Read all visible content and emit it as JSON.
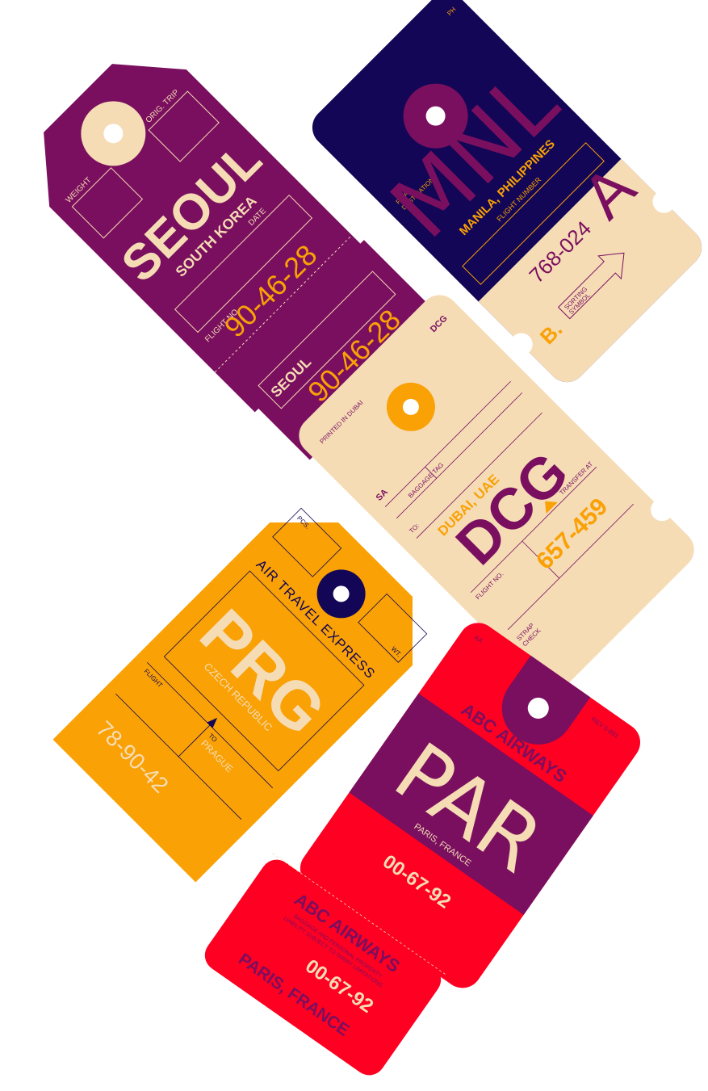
{
  "colors": {
    "plum": "#7a0f5f",
    "navy": "#130656",
    "cream": "#f5dcb5",
    "amber": "#f9a105",
    "red": "#fe0022"
  },
  "tags": {
    "seoul": {
      "orig_trip": "ORIG. TRIP",
      "weight": "WEIGHT",
      "city": "SEOUL",
      "country": "SOUTH KOREA",
      "date": "DATE",
      "flight_no": "FLIGHT NO.",
      "flight_number": "90-46-28",
      "stub_city": "SEOUL",
      "stub_number": "90-46-28"
    },
    "manila": {
      "corner_code": "PH",
      "final_destination_1": "FINAL",
      "final_destination_2": "DESTINATION",
      "code": "MNL",
      "city": "MANILA, PHILIPPINES",
      "flight_number_label": "FLIGHT NUMBER",
      "number": "768-024",
      "letter_a": "A",
      "letter_b": "B.",
      "sorting_1": "SORTING",
      "sorting_2": "SYMBOL"
    },
    "dubai": {
      "printed": "PRINTED IN DUBAI",
      "corner_code": "DCG",
      "sa": "SA",
      "baggage_tag": "BAGGAGE TAG",
      "to": "TO:",
      "city": "DUBAI, UAE",
      "code": "DCG",
      "transfer_at": "TRANSFER AT",
      "flight_no": "FLIGHT NO.",
      "number": "657-459",
      "strap_1": "STRAP",
      "strap_2": "CHECK"
    },
    "prague": {
      "pcs": "PCS.",
      "airline": "AIR TRAVEL EXPRESS",
      "wt": "WT.",
      "code": "PRG",
      "country": "CZECH REPUBLIC",
      "flight": "FLIGHT",
      "to": "TO",
      "city": "PRAGUE",
      "number": "78-90-42"
    },
    "paris": {
      "corner_code": "AA",
      "rev": "REV 5-891",
      "airline": "ABC AIRWAYS",
      "code": "PAR",
      "city": "PARIS, FRANCE",
      "number": "00-67-92",
      "stub_airline": "ABC AIRWAYS",
      "stub_note_1": "BAGGAGE AND PERSONAL PROPERTY",
      "stub_note_2": "LIABILITY SUBJECT TO TARIFF LIMITATIONS.",
      "stub_number": "00-67-92",
      "stub_city": "PARIS, FRANCE"
    }
  }
}
